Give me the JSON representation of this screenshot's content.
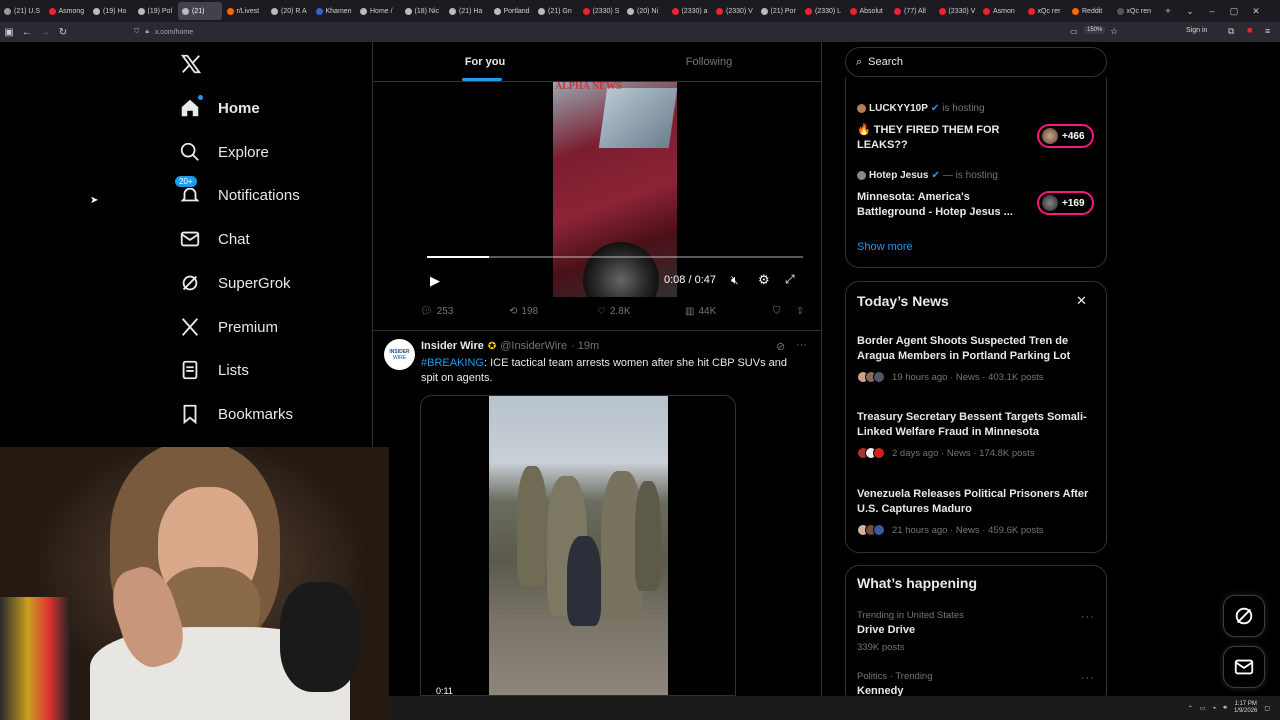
{
  "browser": {
    "tabs": [
      {
        "label": "(21) U.S",
        "fav": "#999"
      },
      {
        "label": "Asmong",
        "fav": "#e23"
      },
      {
        "label": "(19) Ho",
        "fav": "#bbb"
      },
      {
        "label": "(19) Pol",
        "fav": "#bbb"
      },
      {
        "label": "(21)",
        "fav": "#bbb",
        "active": true
      },
      {
        "label": "r/Livest",
        "fav": "#f60"
      },
      {
        "label": "(20) R A",
        "fav": "#bbb"
      },
      {
        "label": "Khamen",
        "fav": "#36c"
      },
      {
        "label": "Home /",
        "fav": "#bbb"
      },
      {
        "label": "(18) Nic",
        "fav": "#bbb"
      },
      {
        "label": "(21) Ha",
        "fav": "#bbb"
      },
      {
        "label": "Portland",
        "fav": "#bbb"
      },
      {
        "label": "(21) Gn",
        "fav": "#bbb"
      },
      {
        "label": "(2330) S",
        "fav": "#e23"
      },
      {
        "label": "(20) Ni",
        "fav": "#bbb"
      },
      {
        "label": "(2330) a",
        "fav": "#e23"
      },
      {
        "label": "(2330) V",
        "fav": "#e23"
      },
      {
        "label": "(21) Por",
        "fav": "#bbb"
      },
      {
        "label": "(2330) L",
        "fav": "#e23"
      },
      {
        "label": "Absolut",
        "fav": "#e23"
      },
      {
        "label": "(77) All",
        "fav": "#e23"
      },
      {
        "label": "(2330) V",
        "fav": "#e23"
      },
      {
        "label": "Asmon",
        "fav": "#e23"
      },
      {
        "label": "xQc rer",
        "fav": "#e23"
      },
      {
        "label": "Reddit",
        "fav": "#f60"
      },
      {
        "label": "xQc ren",
        "fav": "#555"
      }
    ],
    "url": "x.com/home",
    "zoom": "150%",
    "signin": "Sign in"
  },
  "nav": {
    "items": [
      {
        "label": "Home",
        "icon": "home-icon"
      },
      {
        "label": "Explore",
        "icon": "search-icon"
      },
      {
        "label": "Notifications",
        "icon": "bell-icon",
        "badge": "20+"
      },
      {
        "label": "Chat",
        "icon": "mail-icon"
      },
      {
        "label": "SuperGrok",
        "icon": "grok-icon"
      },
      {
        "label": "Premium",
        "icon": "x-logo-icon"
      },
      {
        "label": "Lists",
        "icon": "list-icon"
      },
      {
        "label": "Bookmarks",
        "icon": "bookmark-icon"
      }
    ]
  },
  "feed": {
    "tabs": [
      "For you",
      "Following"
    ],
    "video1": {
      "watermark": "ALPHA NEWS",
      "time": "0:08 / 0:47",
      "progress": 0.165
    },
    "actions1": {
      "replies": "253",
      "reposts": "198",
      "likes": "2.8K",
      "views": "44K"
    },
    "tweet2": {
      "author": "Insider Wire",
      "handle": "@InsiderWire",
      "time": "· 19m",
      "hashtag": "#BREAKING",
      "text": ": ICE tactical team arrests women after she hit CBP SUVs and spit on agents.",
      "avatar_line1": "INSIDER",
      "avatar_line2": "WIRE",
      "video_time": "0:11"
    }
  },
  "sidebar": {
    "search_placeholder": "Search",
    "spaces": [
      {
        "host": "LUCKYY10P",
        "status": "is hosting",
        "title": "🔥 THEY FIRED THEM FOR LEAKS??",
        "count": "+466"
      },
      {
        "host": "Hotep Jesus",
        "status": "— is hosting",
        "title": "Minnesota: America's Battleground - Hotep Jesus ...",
        "count": "+169"
      }
    ],
    "show_more": "Show more",
    "news_title": "Today’s News",
    "news": [
      {
        "title": "Border Agent Shoots Suspected Tren de Aragua Members in Portland Parking Lot",
        "meta": "19 hours ago · News · 403.1K posts"
      },
      {
        "title": "Treasury Secretary Bessent Targets Somali-Linked Welfare Fraud in Minnesota",
        "meta": "2 days ago · News · 174.8K posts"
      },
      {
        "title": "Venezuela Releases Political Prisoners After U.S. Captures Maduro",
        "meta": "21 hours ago · News · 459.6K posts"
      }
    ],
    "happening_title": "What’s happening",
    "trends": [
      {
        "context": "Trending in United States",
        "name": "Drive Drive",
        "posts": "339K posts"
      },
      {
        "context": "Politics · Trending",
        "name": "Kennedy",
        "posts": ""
      }
    ]
  },
  "taskbar": {
    "time": "1:17 PM",
    "date": "1/9/2026"
  }
}
